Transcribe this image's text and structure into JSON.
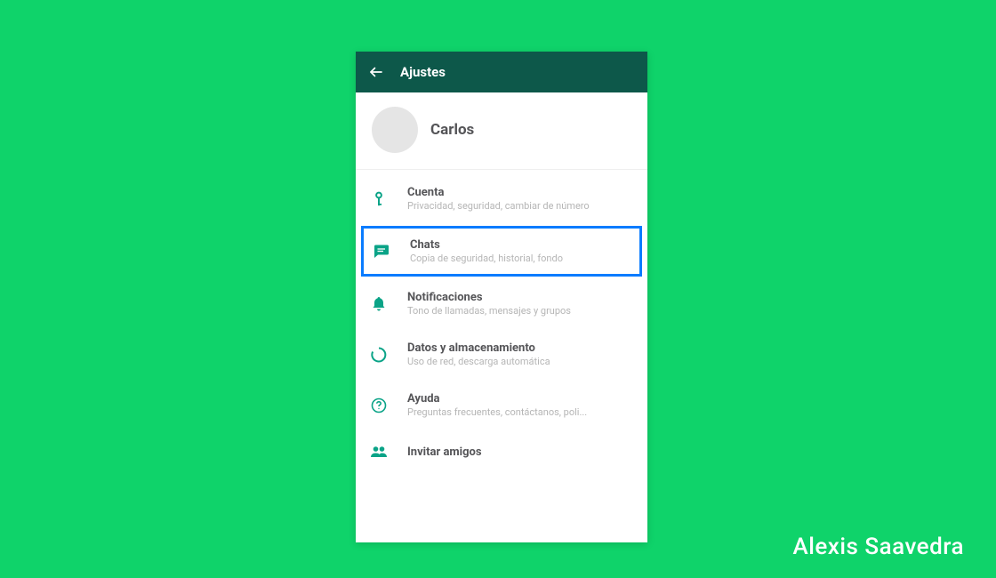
{
  "colors": {
    "background": "#0fd36a",
    "header": "#0d584a",
    "accent": "#0aa387",
    "highlight": "#0a7cff"
  },
  "header": {
    "title": "Ajustes"
  },
  "profile": {
    "name": "Carlos"
  },
  "settings": {
    "account": {
      "title": "Cuenta",
      "subtitle": "Privacidad, seguridad, cambiar de número"
    },
    "chats": {
      "title": "Chats",
      "subtitle": "Copia de seguridad, historial, fondo",
      "highlighted": true
    },
    "notifications": {
      "title": "Notificaciones",
      "subtitle": "Tono de llamadas, mensajes y grupos"
    },
    "data": {
      "title": "Datos y almacenamiento",
      "subtitle": "Uso de red, descarga automática"
    },
    "help": {
      "title": "Ayuda",
      "subtitle": "Preguntas frecuentes, contáctanos, poli..."
    },
    "invite": {
      "title": "Invitar amigos"
    }
  },
  "attribution": "Alexis Saavedra"
}
